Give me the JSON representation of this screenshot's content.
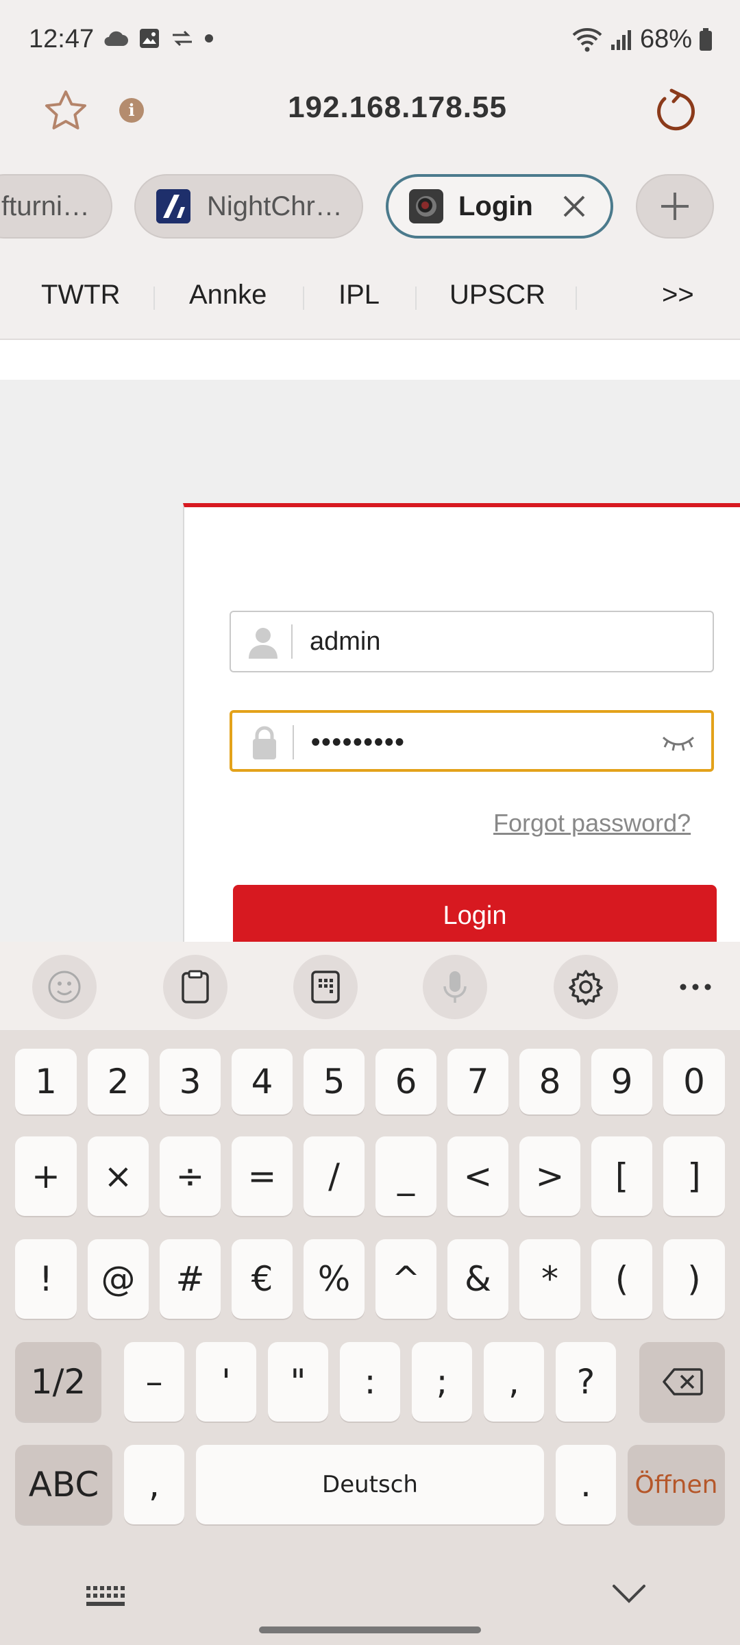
{
  "status_bar": {
    "time": "12:47",
    "battery": "68%"
  },
  "address_bar": {
    "url": "192.168.178.55"
  },
  "tabs": [
    {
      "label": "fturni…"
    },
    {
      "label": "NightChr…"
    },
    {
      "label": "Login"
    }
  ],
  "bookmarks": [
    "TWTR",
    "Annke",
    "IPL",
    "UPSCR"
  ],
  "bookmarks_more": ">>",
  "login": {
    "username": "admin",
    "password_masked": "•••••••••",
    "forgot": "Forgot password?",
    "button": "Login"
  },
  "keyboard": {
    "row1": [
      "1",
      "2",
      "3",
      "4",
      "5",
      "6",
      "7",
      "8",
      "9",
      "0"
    ],
    "row2": [
      "+",
      "×",
      "÷",
      "=",
      "/",
      "_",
      "<",
      ">",
      "[",
      "]"
    ],
    "row3": [
      "!",
      "@",
      "#",
      "€",
      "%",
      "^",
      "&",
      "*",
      "(",
      ")"
    ],
    "row4": [
      "1/2",
      "–",
      "'",
      "\"",
      ":",
      ";",
      ",",
      "?"
    ],
    "abc": "ABC",
    "comma": ",",
    "space": "Deutsch",
    "period": ".",
    "action": "Öffnen"
  },
  "colors": {
    "accent_red": "#d71920",
    "focus_orange": "#e3a21a",
    "active_tab_border": "#4b7a8c"
  }
}
